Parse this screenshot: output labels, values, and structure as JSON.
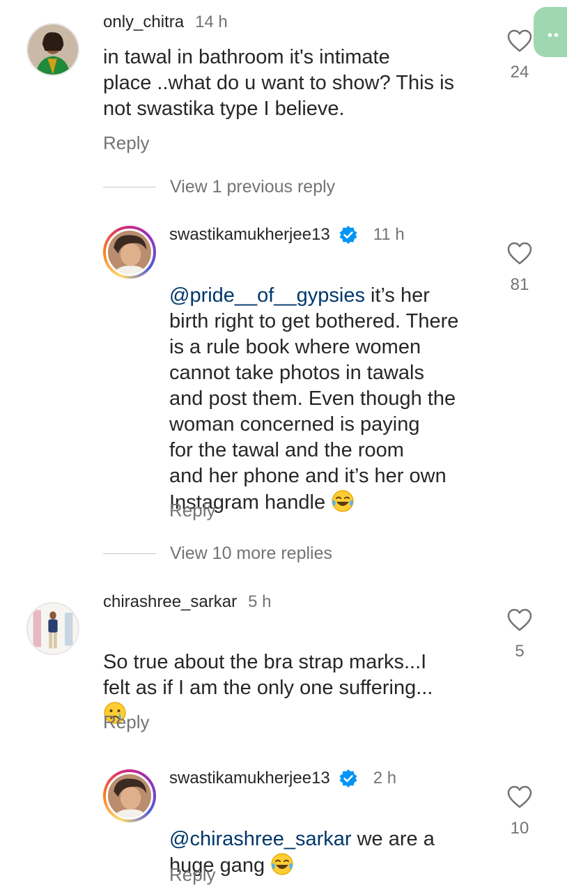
{
  "comments": [
    {
      "username": "only_chitra",
      "time": "14 h",
      "text": "in tawal in bathroom it's intimate\nplace ..what do u want to show? This is\nnot swastika type I believe.",
      "likes": "24",
      "reply_label": "Reply"
    },
    {
      "username": "swastikamukherjee13",
      "time": "11 h",
      "verified": true,
      "mention": "@pride__of__gypsies",
      "text": " it’s her\nbirth right to get bothered. There\nis a rule book where women\ncannot take photos in tawals\nand post them. Even though the\nwoman concerned is paying\nfor the tawal and the room\nand her phone and it’s her own\nInstagram handle ",
      "emoji": "face-with-tears-of-joy",
      "likes": "81",
      "reply_label": "Reply"
    },
    {
      "username": "chirashree_sarkar",
      "time": "5 h",
      "text": "So true about the bra strap marks...I\nfelt as if I am the only one suffering...\n",
      "emoji": "crying-face",
      "likes": "5",
      "reply_label": "Reply"
    },
    {
      "username": "swastikamukherjee13",
      "time": "2 h",
      "verified": true,
      "mention": "@chirashree_sarkar",
      "text": " we are a\nhuge gang ",
      "emoji": "face-with-tears-of-joy",
      "likes": "10",
      "reply_label": "Reply"
    }
  ],
  "view_previous": "View 1 previous reply",
  "view_more": "View 10 more replies",
  "colors": {
    "text": "#262626",
    "secondary": "#737373",
    "mention": "#00376b",
    "verified": "#0095f6"
  }
}
